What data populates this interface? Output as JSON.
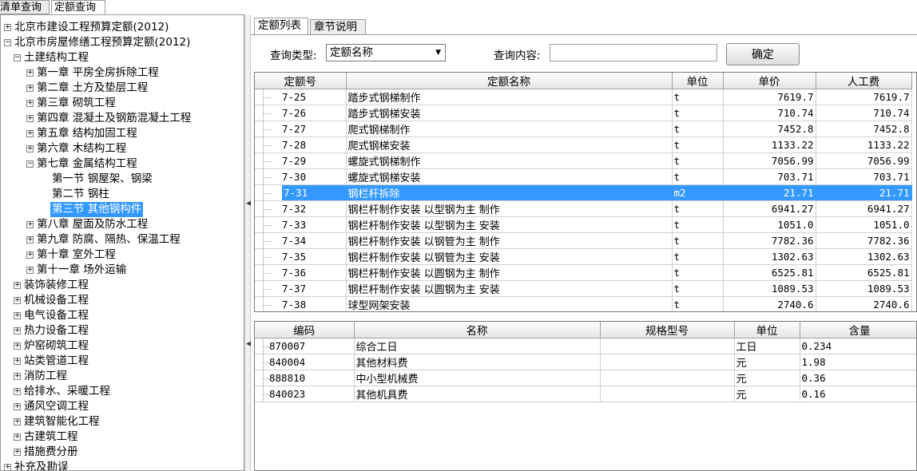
{
  "top_tabs": [
    {
      "label": "清单查询",
      "active": false
    },
    {
      "label": "定额查询",
      "active": true
    }
  ],
  "tree": [
    {
      "level": 0,
      "expander": "+",
      "label": "北京市建设工程预算定额(2012)"
    },
    {
      "level": 0,
      "expander": "-",
      "label": "北京市房屋修缮工程预算定额(2012)"
    },
    {
      "level": 1,
      "expander": "-",
      "label": "土建结构工程"
    },
    {
      "level": 2,
      "expander": "+",
      "label": "第一章 平房全房拆除工程"
    },
    {
      "level": 2,
      "expander": "+",
      "label": "第二章 土方及垫层工程"
    },
    {
      "level": 2,
      "expander": "+",
      "label": "第三章 砌筑工程"
    },
    {
      "level": 2,
      "expander": "+",
      "label": "第四章 混凝土及钢筋混凝土工程"
    },
    {
      "level": 2,
      "expander": "+",
      "label": "第五章 结构加固工程"
    },
    {
      "level": 2,
      "expander": "+",
      "label": "第六章 木结构工程"
    },
    {
      "level": 2,
      "expander": "-",
      "label": "第七章 金属结构工程"
    },
    {
      "level": 3,
      "expander": "",
      "label": "第一节 钢屋架、钢梁"
    },
    {
      "level": 3,
      "expander": "",
      "label": "第二节 钢柱"
    },
    {
      "level": 3,
      "expander": "",
      "label": "第三节 其他钢构件",
      "selected": true
    },
    {
      "level": 2,
      "expander": "+",
      "label": "第八章 屋面及防水工程"
    },
    {
      "level": 2,
      "expander": "+",
      "label": "第九章 防腐、隔热、保温工程"
    },
    {
      "level": 2,
      "expander": "+",
      "label": "第十章 室外工程"
    },
    {
      "level": 2,
      "expander": "+",
      "label": "第十一章 场外运输"
    },
    {
      "level": 1,
      "expander": "+",
      "label": "装饰装修工程"
    },
    {
      "level": 1,
      "expander": "+",
      "label": "机械设备工程"
    },
    {
      "level": 1,
      "expander": "+",
      "label": "电气设备工程"
    },
    {
      "level": 1,
      "expander": "+",
      "label": "热力设备工程"
    },
    {
      "level": 1,
      "expander": "+",
      "label": "炉窑砌筑工程"
    },
    {
      "level": 1,
      "expander": "+",
      "label": "站类管道工程"
    },
    {
      "level": 1,
      "expander": "+",
      "label": "消防工程"
    },
    {
      "level": 1,
      "expander": "+",
      "label": "给排水、采暖工程"
    },
    {
      "level": 1,
      "expander": "+",
      "label": "通风空调工程"
    },
    {
      "level": 1,
      "expander": "+",
      "label": "建筑智能化工程"
    },
    {
      "level": 1,
      "expander": "+",
      "label": "古建筑工程"
    },
    {
      "level": 1,
      "expander": "+",
      "label": "措施费分册"
    },
    {
      "level": 0,
      "expander": "+",
      "label": "补充及勘误"
    }
  ],
  "sub_tabs": [
    {
      "label": "定额列表",
      "active": true
    },
    {
      "label": "章节说明",
      "active": false
    }
  ],
  "query": {
    "type_label": "查询类型:",
    "type_value": "定额名称",
    "content_label": "查询内容:",
    "content_value": "",
    "confirm_label": "确定"
  },
  "quota_table": {
    "headers": [
      "定额号",
      "定额名称",
      "单位",
      "单价",
      "人工费"
    ],
    "rows": [
      {
        "code": "7-25",
        "name": "踏步式钢梯制作",
        "unit": "t",
        "price": "7619.7",
        "labor": "7619.7"
      },
      {
        "code": "7-26",
        "name": "踏步式钢梯安装",
        "unit": "t",
        "price": "710.74",
        "labor": "710.74"
      },
      {
        "code": "7-27",
        "name": "爬式钢梯制作",
        "unit": "t",
        "price": "7452.8",
        "labor": "7452.8"
      },
      {
        "code": "7-28",
        "name": "爬式钢梯安装",
        "unit": "t",
        "price": "1133.22",
        "labor": "1133.22"
      },
      {
        "code": "7-29",
        "name": "螺旋式钢梯制作",
        "unit": "t",
        "price": "7056.99",
        "labor": "7056.99"
      },
      {
        "code": "7-30",
        "name": "螺旋式钢梯安装",
        "unit": "t",
        "price": "703.71",
        "labor": "703.71"
      },
      {
        "code": "7-31",
        "name": "钢栏杆拆除",
        "unit": "m2",
        "price": "21.71",
        "labor": "21.71",
        "selected": true
      },
      {
        "code": "7-32",
        "name": "钢栏杆制作安装 以型钢为主 制作",
        "unit": "t",
        "price": "6941.27",
        "labor": "6941.27"
      },
      {
        "code": "7-33",
        "name": "钢栏杆制作安装 以型钢为主 安装",
        "unit": "t",
        "price": "1051.0",
        "labor": "1051.0"
      },
      {
        "code": "7-34",
        "name": "钢栏杆制作安装 以钢管为主 制作",
        "unit": "t",
        "price": "7782.36",
        "labor": "7782.36"
      },
      {
        "code": "7-35",
        "name": "钢栏杆制作安装 以钢管为主 安装",
        "unit": "t",
        "price": "1302.63",
        "labor": "1302.63"
      },
      {
        "code": "7-36",
        "name": "钢栏杆制作安装 以圆钢为主 制作",
        "unit": "t",
        "price": "6525.81",
        "labor": "6525.81"
      },
      {
        "code": "7-37",
        "name": "钢栏杆制作安装 以圆钢为主 安装",
        "unit": "t",
        "price": "1089.53",
        "labor": "1089.53"
      },
      {
        "code": "7-38",
        "name": "球型网架安装",
        "unit": "t",
        "price": "2740.6",
        "labor": "2740.6"
      }
    ]
  },
  "resource_table": {
    "headers": [
      "编码",
      "名称",
      "规格型号",
      "单位",
      "含量"
    ],
    "rows": [
      {
        "code": "870007",
        "name": "综合工日",
        "spec": "",
        "unit": "工日",
        "qty": "0.234"
      },
      {
        "code": "840004",
        "name": "其他材料费",
        "spec": "",
        "unit": "元",
        "qty": "1.98"
      },
      {
        "code": "888810",
        "name": "中小型机械费",
        "spec": "",
        "unit": "元",
        "qty": "0.36"
      },
      {
        "code": "840023",
        "name": "其他机具费",
        "spec": "",
        "unit": "元",
        "qty": "0.16"
      }
    ]
  },
  "colors": {
    "selection": "#3399ff",
    "border": "#9a9a9a"
  }
}
